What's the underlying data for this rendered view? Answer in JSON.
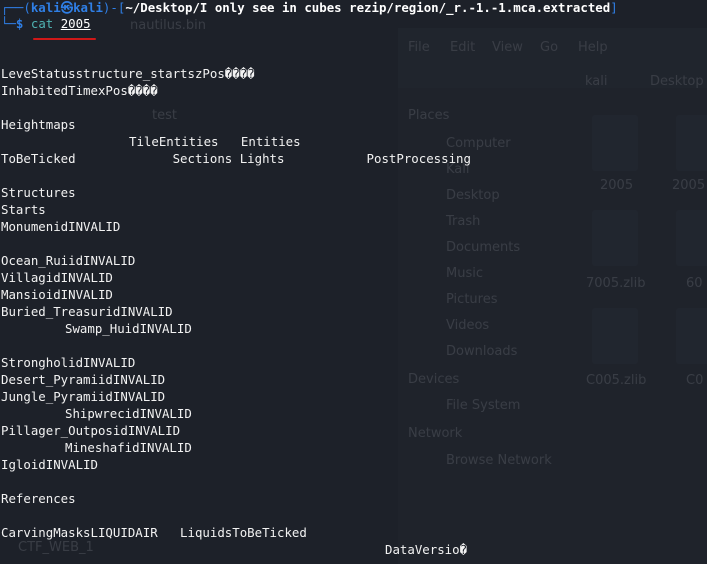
{
  "prompt": {
    "frame_top": "┌──(",
    "user": "kali",
    "at": "㉿",
    "host": "kali",
    "frame_mid": ")-[",
    "path": "~/Desktop/I only see in cubes rezip/region/_r.-1.-1.mca.extracted",
    "frame_end": "]",
    "frame_bottom": "└─",
    "dollar": "$",
    "command": "cat",
    "argument": "2005"
  },
  "output_lines": [
    {
      "text": "LeveStatusstructure_startszPos����",
      "col": 0,
      "row": 4
    },
    {
      "text": "InhabitedTimexPos����",
      "col": 0,
      "row": 5
    },
    {
      "text": "Heightmaps",
      "col": 0,
      "row": 7
    },
    {
      "text": "TileEntities   Entities",
      "col": 16,
      "row": 8
    },
    {
      "text": "ToBeTicked             Sections Lights           PostProcessing",
      "col": 0,
      "row": 9
    },
    {
      "text": "Structures",
      "col": 0,
      "row": 11
    },
    {
      "text": "Starts",
      "col": 0,
      "row": 12
    },
    {
      "text": "MonumenidINVALID",
      "col": 0,
      "row": 13
    },
    {
      "text": "Ocean_RuiidINVALID",
      "col": 0,
      "row": 15
    },
    {
      "text": "VillagidINVALID",
      "col": 0,
      "row": 16
    },
    {
      "text": "MansioidINVALID",
      "col": 0,
      "row": 17
    },
    {
      "text": "Buried_TreasuridINVALID",
      "col": 0,
      "row": 18
    },
    {
      "text": "Swamp_HuidINVALID",
      "col": 8,
      "row": 19
    },
    {
      "text": "StrongholidINVALID",
      "col": 0,
      "row": 21
    },
    {
      "text": "Desert_PyramiidINVALID",
      "col": 0,
      "row": 22
    },
    {
      "text": "Jungle_PyramiidINVALID",
      "col": 0,
      "row": 23
    },
    {
      "text": "ShipwrecidINVALID",
      "col": 8,
      "row": 24
    },
    {
      "text": "Pillager_OutposidINVALID",
      "col": 0,
      "row": 25
    },
    {
      "text": "MineshafidINVALID",
      "col": 8,
      "row": 26
    },
    {
      "text": "IgloidINVALID",
      "col": 0,
      "row": 27
    },
    {
      "text": "References",
      "col": 0,
      "row": 29
    },
    {
      "text": "CarvingMasksLIQUIDAIR   LiquidsToBeTicked",
      "col": 0,
      "row": 31
    },
    {
      "text": "DataVersio�",
      "col": 48,
      "row": 32
    }
  ],
  "background_window": {
    "places_header": "Places",
    "places": [
      "Computer",
      "Kali",
      "Desktop",
      "Trash",
      "Documents",
      "Music",
      "Pictures",
      "Videos",
      "Downloads"
    ],
    "devices_header": "Devices",
    "devices": [
      "File System"
    ],
    "network_header": "Network",
    "network": [
      "Browse Network"
    ],
    "files": [
      "2005",
      "2005",
      "7005.zlib",
      "60",
      "C005.zlib",
      "C0"
    ],
    "menu": [
      "File",
      "Edit",
      "View",
      "Go",
      "Help"
    ],
    "location": [
      "kali",
      "Desktop"
    ],
    "desktop_items": [
      "nautilus.bin",
      "test",
      "CTF_WEB_1"
    ]
  },
  "colors": {
    "background": "#1d2129",
    "prompt_blue": "#2f7fe6",
    "command_teal": "#4fb3b3",
    "annotation_red": "#d01818"
  }
}
